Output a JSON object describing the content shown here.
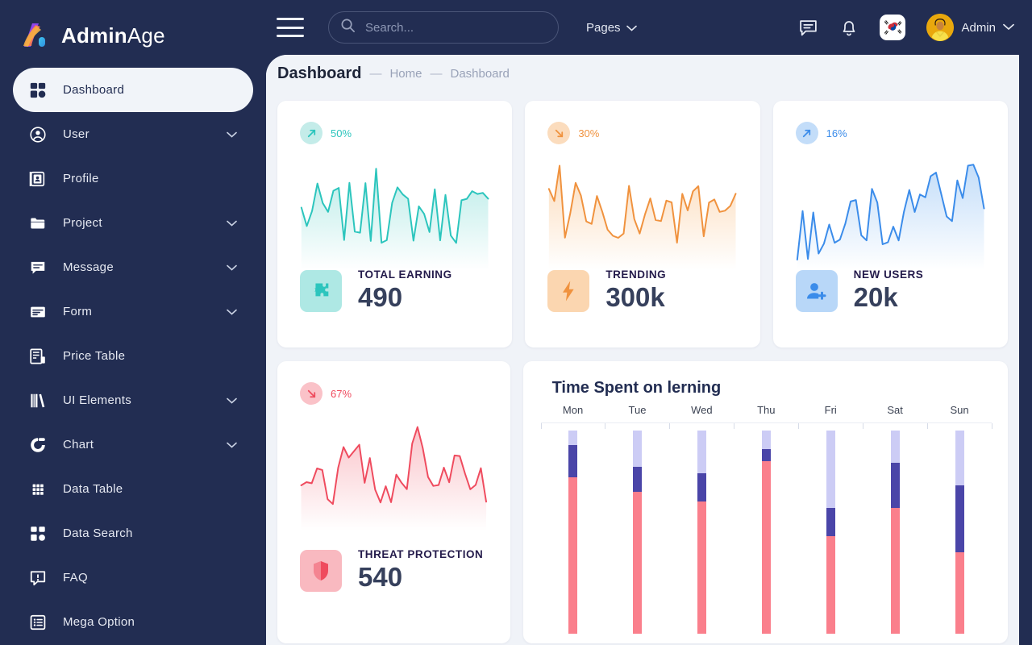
{
  "brand": {
    "name_bold": "Admin",
    "name_light": "Age",
    "logo_icon": "admin-age-logo"
  },
  "sidebar": {
    "items": [
      {
        "label": "Dashboard",
        "icon": "grid-icon",
        "active": true,
        "caret": false
      },
      {
        "label": "User",
        "icon": "user-circle-icon",
        "active": false,
        "caret": true
      },
      {
        "label": "Profile",
        "icon": "id-card-icon",
        "active": false,
        "caret": false
      },
      {
        "label": "Project",
        "icon": "folder-icon",
        "active": false,
        "caret": true
      },
      {
        "label": "Message",
        "icon": "chat-icon",
        "active": false,
        "caret": true
      },
      {
        "label": "Form",
        "icon": "form-icon",
        "active": false,
        "caret": true
      },
      {
        "label": "Price Table",
        "icon": "price-table-icon",
        "active": false,
        "caret": false
      },
      {
        "label": "UI Elements",
        "icon": "books-icon",
        "active": false,
        "caret": true
      },
      {
        "label": "Chart",
        "icon": "donut-chart-icon",
        "active": false,
        "caret": true
      },
      {
        "label": "Data Table",
        "icon": "dots-grid-icon",
        "active": false,
        "caret": false
      },
      {
        "label": "Data Search",
        "icon": "grid-icon",
        "active": false,
        "caret": false
      },
      {
        "label": "FAQ",
        "icon": "faq-icon",
        "active": false,
        "caret": false
      },
      {
        "label": "Mega Option",
        "icon": "list-box-icon",
        "active": false,
        "caret": false
      }
    ]
  },
  "topbar": {
    "menu_toggle_icon": "hamburger-icon",
    "search": {
      "value": "",
      "placeholder": "Search...",
      "icon": "search-icon"
    },
    "pages_label": "Pages",
    "pages_caret_icon": "chevron-down-icon",
    "messages_icon": "chat-icon",
    "notifications_icon": "bell-icon",
    "language_flag": "korea-flag-icon",
    "user_name": "Admin",
    "user_caret_icon": "chevron-down-icon",
    "avatar_icon": "user-avatar"
  },
  "breadcrumb": {
    "title": "Dashboard",
    "sep": "—",
    "home": "Home",
    "current": "Dashboard"
  },
  "colors": {
    "sidebar_bg": "#222d52",
    "content_bg": "#f0f3f8",
    "teal": "#2cc5bd",
    "orange": "#f0923e",
    "blue": "#3b8cea",
    "red": "#ef4b5e",
    "bar_light": "#ccccf5",
    "bar_dark": "#4a45a8",
    "bar_pink": "#fa7f8c"
  },
  "stats": [
    {
      "percent": "50%",
      "trend": "up",
      "label": "Total Earning",
      "value": "490",
      "icon": "puzzle-icon",
      "accent": "#2cc5bd",
      "soft": "#aee8e4",
      "badge_bg": "#c4ece9"
    },
    {
      "percent": "30%",
      "trend": "down",
      "label": "Trending",
      "value": "300k",
      "icon": "bolt-icon",
      "accent": "#f0923e",
      "soft": "#fbd6b0",
      "badge_bg": "#fbdcbd"
    },
    {
      "percent": "16%",
      "trend": "up",
      "label": "New Users",
      "value": "20k",
      "icon": "user-plus-icon",
      "accent": "#3b8cea",
      "soft": "#b8d7f8",
      "badge_bg": "#c3ddf9"
    },
    {
      "percent": "67%",
      "trend": "down",
      "label": "Threat Protection",
      "value": "540",
      "icon": "shield-icon",
      "accent": "#ef4b5e",
      "soft": "#f9b9c0",
      "badge_bg": "#fac2c8"
    }
  ],
  "chart_data": {
    "type": "bar",
    "title": "Time Spent on lerning",
    "stacked": true,
    "categories": [
      "Mon",
      "Tue",
      "Wed",
      "Thu",
      "Fri",
      "Sat",
      "Sun"
    ],
    "series": [
      {
        "name": "Pink",
        "color": "#fa7f8c",
        "values": [
          77,
          70,
          65,
          85,
          48,
          62,
          40
        ]
      },
      {
        "name": "Dark Blue",
        "color": "#4a45a8",
        "values": [
          16,
          12,
          14,
          6,
          14,
          22,
          33
        ]
      },
      {
        "name": "Light Blue",
        "color": "#ccccf5",
        "values": [
          7,
          18,
          21,
          9,
          38,
          16,
          27
        ]
      }
    ],
    "xlabel": "",
    "ylabel": "",
    "ylim": [
      0,
      100
    ],
    "grid": false,
    "legend": "none"
  }
}
